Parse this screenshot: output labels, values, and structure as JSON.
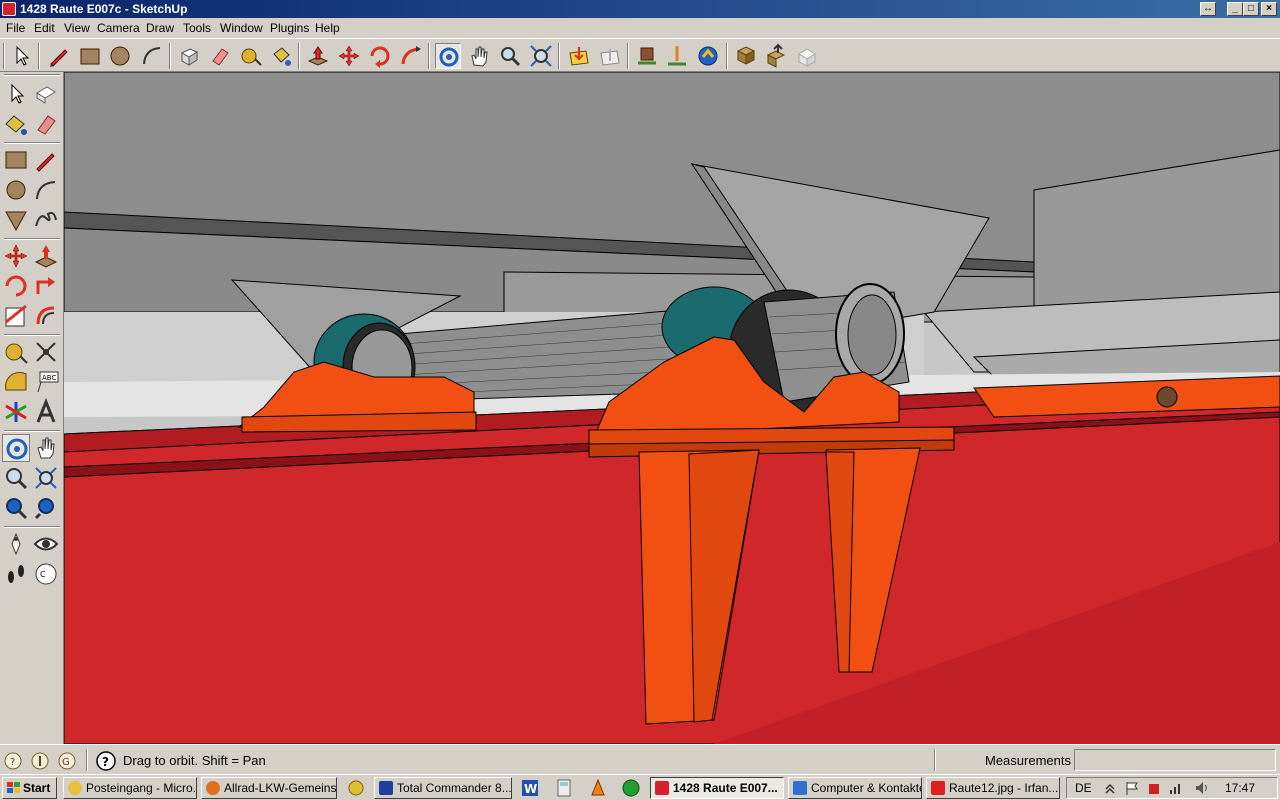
{
  "window": {
    "title": "1428 Raute E007c - SketchUp",
    "controls": [
      "restore-down",
      "minimize",
      "maximize",
      "close"
    ]
  },
  "menu": {
    "items": [
      {
        "label": "File"
      },
      {
        "label": "Edit"
      },
      {
        "label": "View"
      },
      {
        "label": "Camera"
      },
      {
        "label": "Draw"
      },
      {
        "label": "Tools"
      },
      {
        "label": "Window"
      },
      {
        "label": "Plugins"
      },
      {
        "label": "Help"
      }
    ]
  },
  "toolbar_top": {
    "tools": [
      "select",
      "pencil",
      "rectangle",
      "circle",
      "arc",
      "make-component",
      "eraser",
      "tape-measure",
      "paint-bucket",
      "push-pull",
      "move",
      "rotate",
      "follow-me",
      "orbit",
      "pan",
      "zoom",
      "zoom-extents",
      "get-models",
      "share-model",
      "add-location",
      "toggle-terrain",
      "photo-textures",
      "get-photo-texture",
      "share-component",
      "3d-warehouse"
    ],
    "active_tool": "orbit"
  },
  "toolbar_left": {
    "tools": [
      "select",
      "make-component",
      "paint-bucket",
      "eraser",
      "rectangle",
      "line",
      "circle",
      "arc",
      "polygon",
      "freehand",
      "move",
      "push-pull",
      "rotate",
      "follow-me",
      "scale",
      "offset",
      "tape-measure",
      "dimension",
      "protractor",
      "text",
      "axes",
      "3d-text",
      "orbit",
      "pan",
      "zoom",
      "zoom-window",
      "zoom-extents",
      "previous",
      "position-camera",
      "look-around",
      "walk",
      "section-plane"
    ],
    "active_tool": "orbit"
  },
  "status": {
    "message": "Drag to orbit.  Shift = Pan",
    "measurements_label": "Measurements",
    "measurements_value": ""
  },
  "taskbar": {
    "start_label": "Start",
    "tasks": [
      {
        "label": "Posteingang - Micro...",
        "active": false
      },
      {
        "label": "Allrad-LKW-Gemeins...",
        "active": false
      },
      {
        "label": "Total Commander 8....",
        "active": false
      },
      {
        "label": "1428 Raute E007...",
        "active": true
      },
      {
        "label": "Computer & Kontakte",
        "active": false
      },
      {
        "label": "Raute12.jpg - Irfan...",
        "active": false
      }
    ],
    "language": "DE",
    "clock": "17:47"
  },
  "colors": {
    "titlebar_start": "#0a246a",
    "frame_red": "#d0272b",
    "bracket_orange": "#f24f12",
    "bushing_teal": "#1a6b6e",
    "steel_gray": "#8e8e8e"
  }
}
